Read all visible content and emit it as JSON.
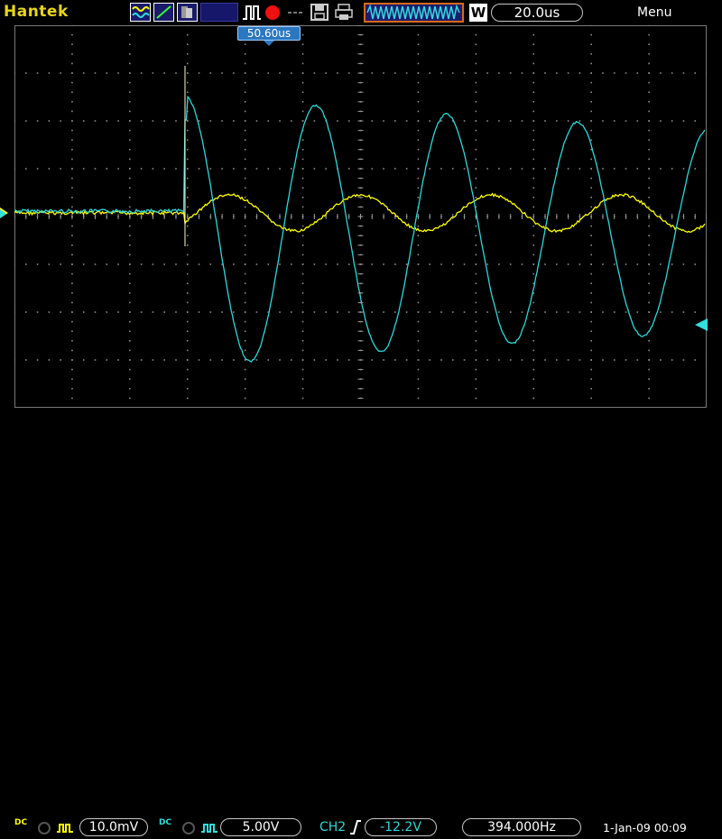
{
  "header": {
    "brand": "Hantek",
    "timebase": "20.0us",
    "w_badge": "W",
    "menu": "Menu"
  },
  "trigger_marker": {
    "time": "50.60us"
  },
  "footer": {
    "ch1_scale": "10.0mV",
    "ch2_scale": "5.00V",
    "ch1_coupling": "DC",
    "ch2_coupling": "DC",
    "trigger_source": "CH2",
    "trigger_level": "-12.2V",
    "frequency": "394.000Hz",
    "date": "1-Jan-09 00:09"
  },
  "colors": {
    "ch1": "#ffff00",
    "ch2": "#2fd7d7",
    "brand": "#e7d51c",
    "accent_orange": "#d86a1a",
    "marker_blue": "#2b77c0"
  },
  "icons": [
    "mode-icon",
    "draw-mode-icon",
    "persist-icon",
    "pulse-icon",
    "record-icon",
    "dots-icon",
    "save-icon",
    "print-icon",
    "waveform-icon"
  ]
}
